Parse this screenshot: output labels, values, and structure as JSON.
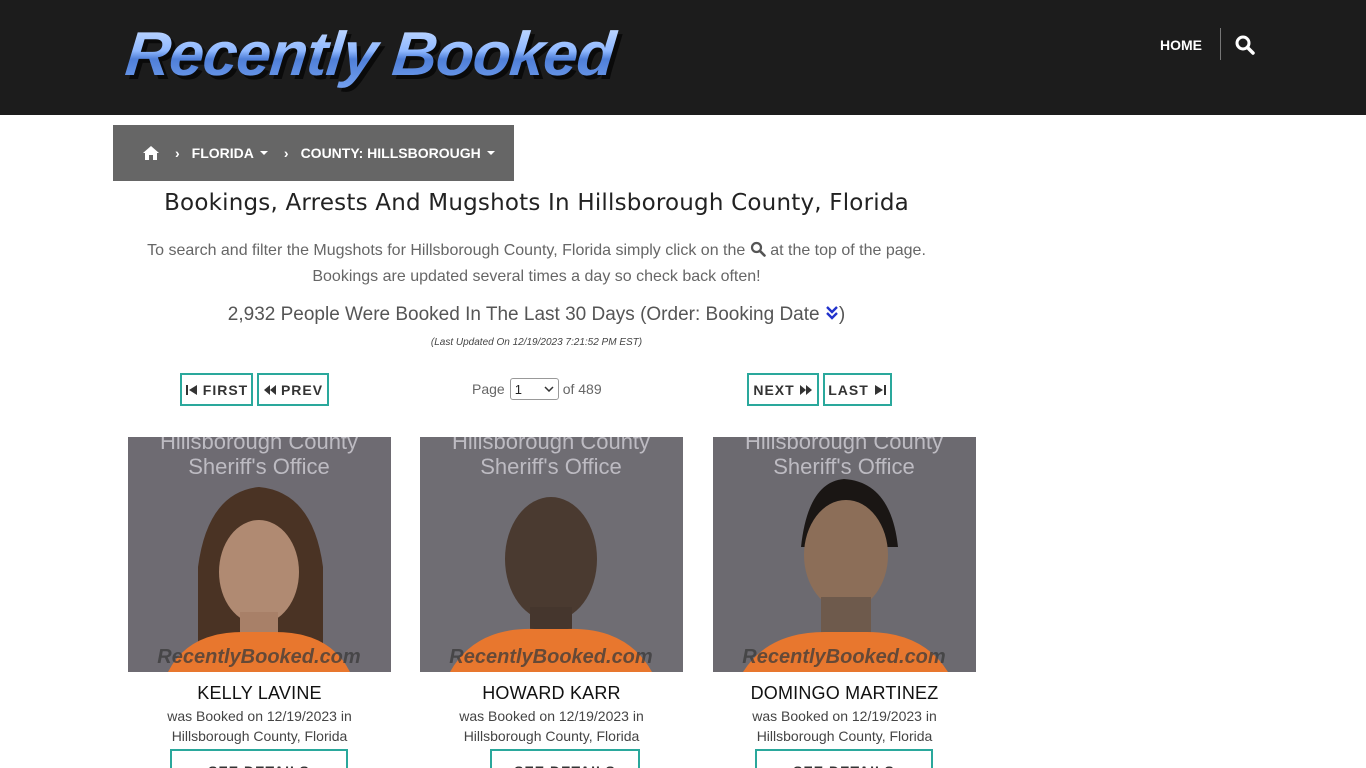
{
  "header": {
    "logo_text": "Recently Booked",
    "nav_home": "HOME"
  },
  "breadcrumb": {
    "state": "FLORIDA",
    "county": "COUNTY: HILLSBOROUGH"
  },
  "main": {
    "title": "Bookings, Arrests And Mugshots In Hillsborough County, Florida",
    "intro_before_icon": "To search and filter the Mugshots for Hillsborough County, Florida simply click on the",
    "intro_after_icon": "at the top of the page.",
    "intro_line2": "Bookings are updated several times a day so check back often!",
    "count_text": "2,932 People Were Booked In The Last 30 Days (Order: Booking Date",
    "count_close": ")",
    "last_updated": "(Last Updated On 12/19/2023 7:21:52 PM EST)"
  },
  "pagination": {
    "first": "FIRST",
    "prev": "PREV",
    "next": "NEXT",
    "last": "LAST",
    "page_label": "Page",
    "current_page": "1",
    "of_label": "of 489"
  },
  "mugshots": [
    {
      "name": "KELLY LAVINE",
      "desc_line1": "was Booked on 12/19/2023 in",
      "desc_line2": "Hillsborough County, Florida",
      "button": "SEE DETAILS"
    },
    {
      "name": "HOWARD KARR",
      "desc_line1": "was Booked on 12/19/2023 in",
      "desc_line2": "Hillsborough County, Florida",
      "button": "SEE DETAILS"
    },
    {
      "name": "DOMINGO MARTINEZ",
      "desc_line1": "was Booked on 12/19/2023 in",
      "desc_line2": "Hillsborough County, Florida",
      "button": "SEE DETAILS"
    }
  ],
  "photo_watermark": {
    "agency_line1": "Hillsborough County",
    "agency_line2": "Sheriff's Office",
    "site": "RecentlyBooked.com"
  },
  "colors": {
    "header_bg": "#1c1c1c",
    "breadcrumb_bg": "#666666",
    "button_border": "#2aa89c",
    "order_icon": "#2233cc"
  }
}
